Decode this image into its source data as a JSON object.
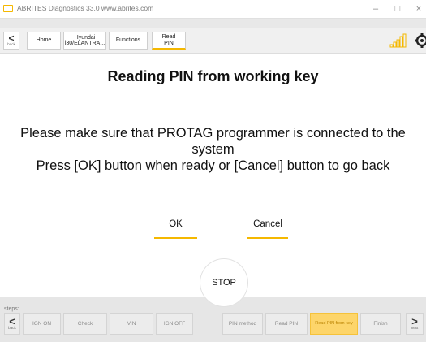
{
  "window": {
    "title": "ABRITES Diagnostics 33.0   www.abrites.com",
    "minimize_label": "–",
    "maximize_label": "□",
    "close_label": "×"
  },
  "nav": {
    "back_label": "back",
    "items": [
      {
        "label": "Home"
      },
      {
        "label": "Hyundai\ni30/ELANTRA..."
      },
      {
        "label": "Functions"
      },
      {
        "label": "Read\nPIN"
      }
    ]
  },
  "main": {
    "heading": "Reading PIN from working key",
    "message_line1": "Please make sure that PROTAG programmer is connected to the",
    "message_line2": "system",
    "message_line3": "Press [OK] button when ready or [Cancel] button to go back",
    "ok_label": "OK",
    "cancel_label": "Cancel",
    "stop_label": "STOP"
  },
  "steps": {
    "label": "steps:",
    "back_label": "back",
    "next_label": "next",
    "items": [
      {
        "label": "IGN ON"
      },
      {
        "label": "Check"
      },
      {
        "label": "VIN"
      },
      {
        "label": "IGN OFF"
      },
      {
        "label": "PIN method"
      },
      {
        "label": "Read PIN"
      },
      {
        "label": "Read PIN from key"
      },
      {
        "label": "Finish"
      }
    ]
  },
  "colors": {
    "accent": "#f5b800",
    "current_step": "#fdd56a"
  }
}
